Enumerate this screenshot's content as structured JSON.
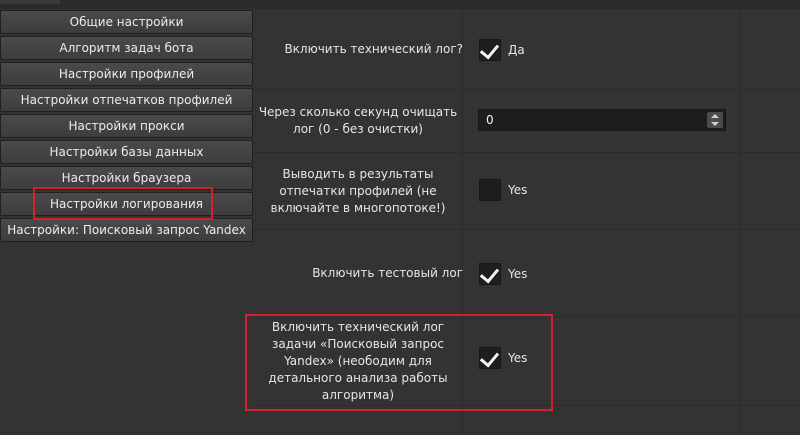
{
  "sidebar": {
    "items": [
      {
        "label": "Общие настройки"
      },
      {
        "label": "Алгоритм задач бота"
      },
      {
        "label": "Настройки профилей"
      },
      {
        "label": "Настройки отпечатков профилей"
      },
      {
        "label": "Настройки прокси"
      },
      {
        "label": "Настройки базы данных"
      },
      {
        "label": "Настройки браузера"
      },
      {
        "label": "Настройки логирования"
      },
      {
        "label": "Настройки: Поисковый запрос Yandex"
      }
    ],
    "highlighted_item": "Настройки логирования"
  },
  "settings": {
    "tech_log": {
      "label": "Включить технический лог?",
      "checked": true,
      "value_label": "Да"
    },
    "clear_log": {
      "label": "Через сколько секунд очищать лог (0 - без очистки)",
      "value": "0"
    },
    "fingerprints": {
      "label": "Выводить в результаты отпечатки профилей (не включайте в многопотоке!)",
      "checked": false,
      "value_label": "Yes"
    },
    "test_log": {
      "label": "Включить тестовый лог",
      "checked": true,
      "value_label": "Yes"
    },
    "task_tech_log": {
      "label": "Включить технический лог задачи «Поисковый запрос Yandex» (неободим для детального анализа работы алгоритма)",
      "checked": true,
      "value_label": "Yes"
    }
  },
  "colors": {
    "highlight": "#d2232a",
    "background": "#333333"
  }
}
